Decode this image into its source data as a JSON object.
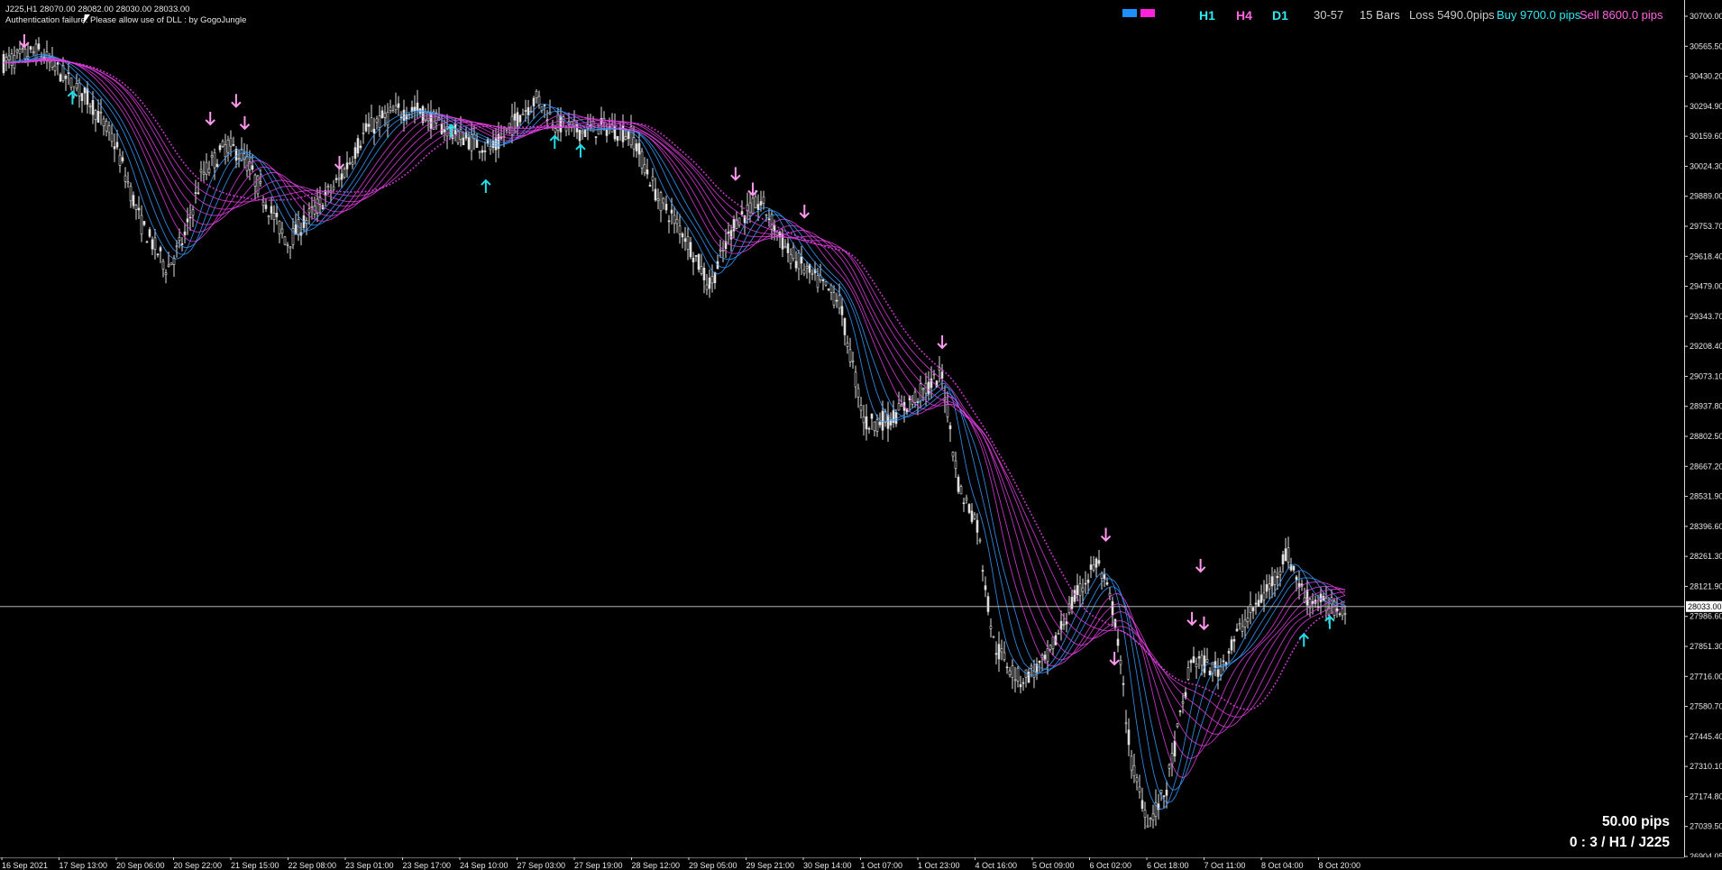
{
  "chart": {
    "symbol_line": "J225,H1  28070.00 28082.00 28030.00 28033.00",
    "message": "Authentication failure. Please allow use of DLL : by GogoJungle",
    "current_price": "28033.00",
    "current_price_value": 28033.0,
    "price_min": 26904.05,
    "price_max": 30700.0
  },
  "hud": {
    "timeframes": [
      "H1",
      "H4",
      "D1"
    ],
    "active_timeframe": "H4",
    "range": "30-57",
    "bars": "15 Bars",
    "loss_label": "Loss 5490.0pips",
    "buy_label": "Buy 9700.0 pips",
    "sell_label": "Sell 8600.0 pips"
  },
  "corner": {
    "pips": "50.00 pips",
    "status": "0 : 3    / H1 /        J225"
  },
  "price_axis": [
    "30700.00",
    "30565.50",
    "30430.20",
    "30294.90",
    "30159.60",
    "30024.30",
    "29889.00",
    "29753.70",
    "29618.40",
    "29479.00",
    "29343.70",
    "29208.40",
    "29073.10",
    "28937.80",
    "28802.50",
    "28667.20",
    "28531.90",
    "28396.60",
    "28261.30",
    "28121.90",
    "27986.60",
    "27851.30",
    "27716.00",
    "27580.70",
    "27445.40",
    "27310.10",
    "27174.80",
    "27039.50",
    "26904.05"
  ],
  "time_axis": [
    "16 Sep 2021",
    "17 Sep 13:00",
    "20 Sep 06:00",
    "20 Sep 22:00",
    "21 Sep 15:00",
    "22 Sep 08:00",
    "23 Sep 01:00",
    "23 Sep 17:00",
    "24 Sep 10:00",
    "27 Sep 03:00",
    "27 Sep 19:00",
    "28 Sep 12:00",
    "29 Sep 05:00",
    "29 Sep 21:00",
    "30 Sep 14:00",
    "1 Oct 07:00",
    "1 Oct 23:00",
    "4 Oct 16:00",
    "5 Oct 09:00",
    "6 Oct 02:00",
    "6 Oct 18:00",
    "7 Oct 11:00",
    "8 Oct 04:00",
    "8 Oct 20:00"
  ],
  "colors": {
    "background": "#000000",
    "candle": "#e0e0e0",
    "band_down": "#e040e0",
    "band_up": "#3a9cff",
    "arrow_sell": "#ff99ee",
    "arrow_buy": "#22dde8",
    "loss": "#c8c8c8",
    "buy": "#2ee8f2",
    "sell": "#ff66e0"
  },
  "series_path": [
    [
      0,
      30490
    ],
    [
      0.02,
      30540
    ],
    [
      0.035,
      30430
    ],
    [
      0.05,
      30320
    ],
    [
      0.065,
      30120
    ],
    [
      0.08,
      29760
    ],
    [
      0.095,
      29560
    ],
    [
      0.105,
      29700
    ],
    [
      0.115,
      29980
    ],
    [
      0.13,
      30120
    ],
    [
      0.14,
      30060
    ],
    [
      0.155,
      29820
    ],
    [
      0.165,
      29680
    ],
    [
      0.18,
      29820
    ],
    [
      0.195,
      29960
    ],
    [
      0.21,
      30180
    ],
    [
      0.225,
      30260
    ],
    [
      0.24,
      30280
    ],
    [
      0.255,
      30200
    ],
    [
      0.27,
      30140
    ],
    [
      0.285,
      30100
    ],
    [
      0.3,
      30260
    ],
    [
      0.31,
      30330
    ],
    [
      0.32,
      30220
    ],
    [
      0.335,
      30180
    ],
    [
      0.35,
      30200
    ],
    [
      0.365,
      30160
    ],
    [
      0.38,
      29880
    ],
    [
      0.395,
      29720
    ],
    [
      0.41,
      29480
    ],
    [
      0.425,
      29780
    ],
    [
      0.44,
      29860
    ],
    [
      0.455,
      29640
    ],
    [
      0.47,
      29520
    ],
    [
      0.485,
      29420
    ],
    [
      0.5,
      28860
    ],
    [
      0.515,
      28880
    ],
    [
      0.53,
      28980
    ],
    [
      0.545,
      29080
    ],
    [
      0.555,
      28560
    ],
    [
      0.565,
      28420
    ],
    [
      0.575,
      27860
    ],
    [
      0.59,
      27700
    ],
    [
      0.605,
      27780
    ],
    [
      0.62,
      28040
    ],
    [
      0.635,
      28240
    ],
    [
      0.645,
      28000
    ],
    [
      0.655,
      27320
    ],
    [
      0.665,
      27060
    ],
    [
      0.675,
      27200
    ],
    [
      0.69,
      27800
    ],
    [
      0.705,
      27740
    ],
    [
      0.72,
      27960
    ],
    [
      0.735,
      28120
    ],
    [
      0.745,
      28280
    ],
    [
      0.755,
      28080
    ],
    [
      0.77,
      28030
    ],
    [
      0.78,
      28033
    ]
  ],
  "sell_arrows": [
    [
      0.012,
      30590
    ],
    [
      0.12,
      30240
    ],
    [
      0.135,
      30320
    ],
    [
      0.14,
      30220
    ],
    [
      0.195,
      30040
    ],
    [
      0.425,
      29990
    ],
    [
      0.435,
      29920
    ],
    [
      0.465,
      29820
    ],
    [
      0.545,
      29230
    ],
    [
      0.64,
      28360
    ],
    [
      0.645,
      27800
    ],
    [
      0.695,
      28220
    ],
    [
      0.69,
      27980
    ],
    [
      0.697,
      27960
    ]
  ],
  "buy_arrows": [
    [
      0.04,
      30330
    ],
    [
      0.26,
      30180
    ],
    [
      0.28,
      29930
    ],
    [
      0.32,
      30130
    ],
    [
      0.335,
      30090
    ],
    [
      0.755,
      27880
    ],
    [
      0.77,
      27960
    ]
  ]
}
